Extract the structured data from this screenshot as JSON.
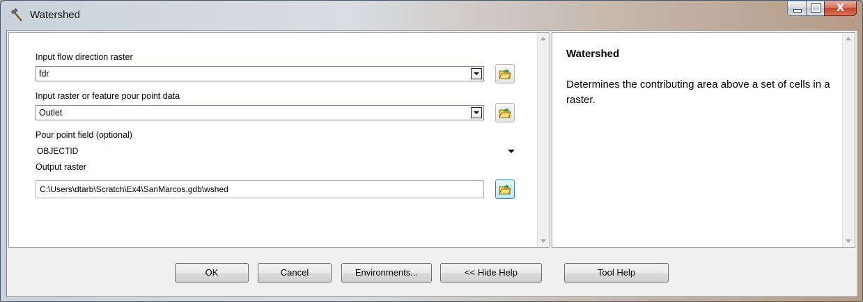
{
  "window": {
    "title": "Watershed",
    "icon": "hammer-icon",
    "caption_buttons": [
      "minimize-icon",
      "maximize-icon",
      "close-icon"
    ],
    "close_glyph": "X"
  },
  "params": {
    "flow_dir": {
      "label": "Input flow direction raster",
      "value": "fdr"
    },
    "pour_point": {
      "label": "Input raster or feature pour point data",
      "value": "Outlet"
    },
    "pour_field": {
      "label": "Pour point field (optional)",
      "value": "OBJECTID"
    },
    "output": {
      "label": "Output raster",
      "value": "C:\\Users\\dtarb\\Scratch\\Ex4\\SanMarcos.gdb\\wshed"
    }
  },
  "help": {
    "title": "Watershed",
    "description": "Determines the contributing area above a set of cells in a raster."
  },
  "buttons": {
    "ok": "OK",
    "cancel": "Cancel",
    "environments": "Environments...",
    "hide_help": "<< Hide Help",
    "tool_help": "Tool Help"
  },
  "colors": {
    "folder_yellow": "#f2c94c",
    "folder_green_arrow": "#2e9e3a",
    "active_blue": "#3c7fb1"
  }
}
